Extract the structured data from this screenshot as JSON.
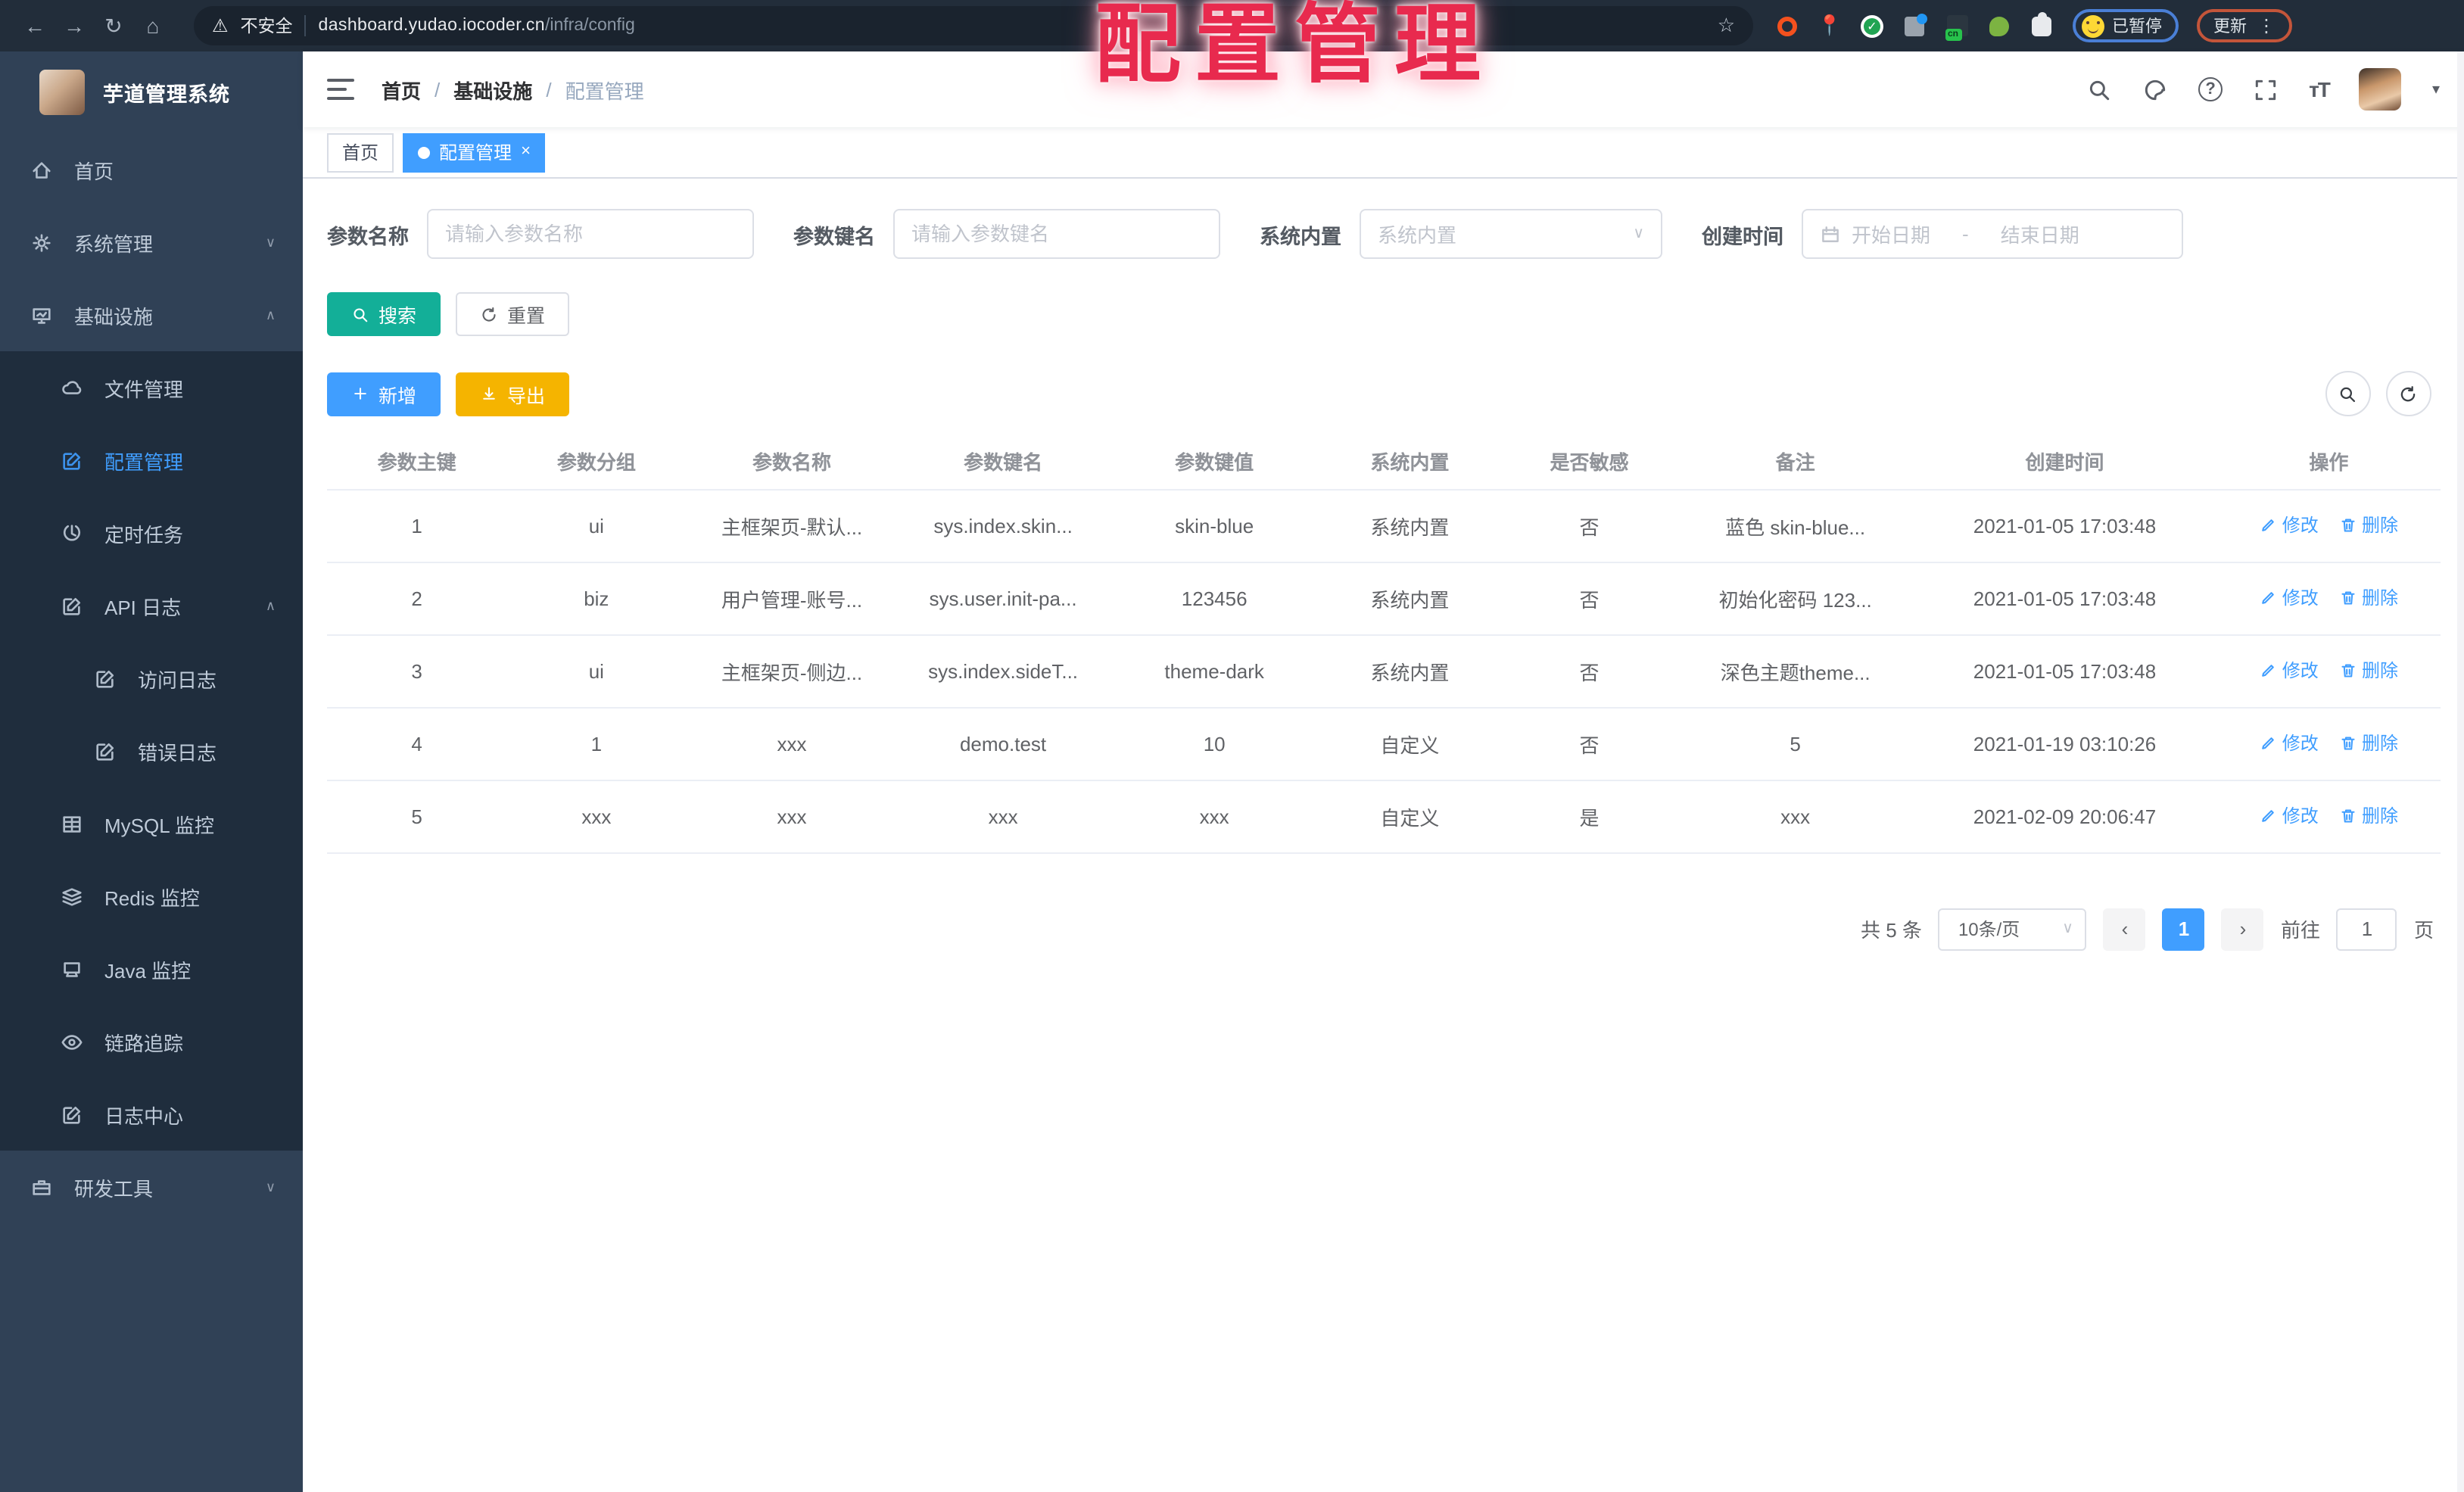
{
  "overlay": {
    "title": "配置管理"
  },
  "chrome": {
    "security_label": "不安全",
    "url_host": "dashboard.yudao.iocoder.cn",
    "url_path": "/infra/config",
    "cn_badge": "cn",
    "paused_label": "已暂停",
    "update_label": "更新"
  },
  "sidebar": {
    "app_title": "芋道管理系统",
    "items": [
      {
        "label": "首页"
      },
      {
        "label": "系统管理"
      },
      {
        "label": "基础设施"
      },
      {
        "label": "文件管理"
      },
      {
        "label": "配置管理"
      },
      {
        "label": "定时任务"
      },
      {
        "label": "API 日志"
      },
      {
        "label": "访问日志"
      },
      {
        "label": "错误日志"
      },
      {
        "label": "MySQL 监控"
      },
      {
        "label": "Redis 监控"
      },
      {
        "label": "Java 监控"
      },
      {
        "label": "链路追踪"
      },
      {
        "label": "日志中心"
      },
      {
        "label": "研发工具"
      }
    ]
  },
  "navbar": {
    "breadcrumb": [
      "首页",
      "基础设施",
      "配置管理"
    ],
    "separator": "/"
  },
  "tabs": [
    {
      "label": "首页"
    },
    {
      "label": "配置管理"
    }
  ],
  "filters": {
    "param_name_label": "参数名称",
    "param_name_placeholder": "请输入参数名称",
    "param_key_label": "参数键名",
    "param_key_placeholder": "请输入参数键名",
    "builtin_label": "系统内置",
    "builtin_placeholder": "系统内置",
    "create_time_label": "创建时间",
    "date_start_placeholder": "开始日期",
    "date_separator": "-",
    "date_end_placeholder": "结束日期"
  },
  "toolbar": {
    "search_label": "搜索",
    "reset_label": "重置",
    "add_label": "新增",
    "export_label": "导出"
  },
  "table": {
    "headers": [
      "参数主键",
      "参数分组",
      "参数名称",
      "参数键名",
      "参数键值",
      "系统内置",
      "是否敏感",
      "备注",
      "创建时间",
      "操作"
    ],
    "action_edit": "修改",
    "action_delete": "删除",
    "rows": [
      {
        "cells": [
          "1",
          "ui",
          "主框架页-默认...",
          "sys.index.skin...",
          "skin-blue",
          "系统内置",
          "否",
          "蓝色 skin-blue...",
          "2021-01-05 17:03:48"
        ]
      },
      {
        "cells": [
          "2",
          "biz",
          "用户管理-账号...",
          "sys.user.init-pa...",
          "123456",
          "系统内置",
          "否",
          "初始化密码 123...",
          "2021-01-05 17:03:48"
        ]
      },
      {
        "cells": [
          "3",
          "ui",
          "主框架页-侧边...",
          "sys.index.sideT...",
          "theme-dark",
          "系统内置",
          "否",
          "深色主题theme...",
          "2021-01-05 17:03:48"
        ]
      },
      {
        "cells": [
          "4",
          "1",
          "xxx",
          "demo.test",
          "10",
          "自定义",
          "否",
          "5",
          "2021-01-19 03:10:26"
        ]
      },
      {
        "cells": [
          "5",
          "xxx",
          "xxx",
          "xxx",
          "xxx",
          "自定义",
          "是",
          "xxx",
          "2021-02-09 20:06:47"
        ]
      }
    ]
  },
  "pagination": {
    "total_label": "共 5 条",
    "page_size_label": "10条/页",
    "current_page": "1",
    "goto_label": "前往",
    "goto_value": "1",
    "page_unit_label": "页"
  },
  "colors": {
    "accent": "#409eff",
    "sidebar_bg": "#304156",
    "submenu_bg": "#1f2d3d",
    "search_teal": "#13af98",
    "export_yellow": "#f5b400",
    "overlay_red": "#e82a4e",
    "chrome_bg": "#222d3a"
  }
}
